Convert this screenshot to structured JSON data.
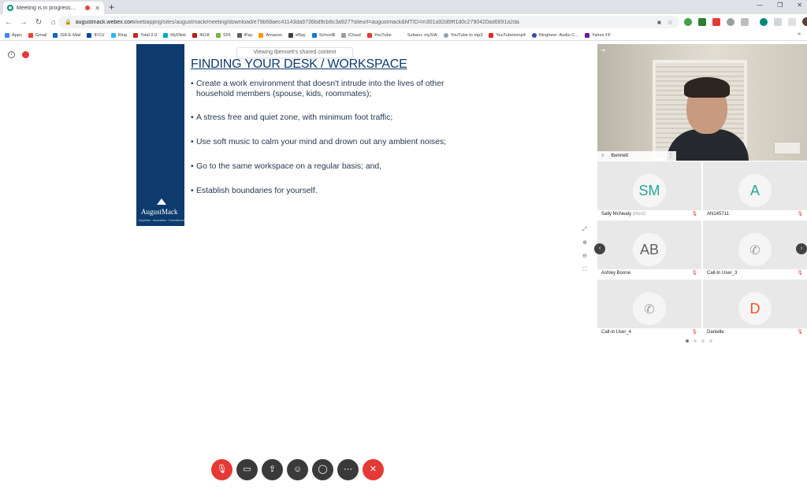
{
  "browser": {
    "tab_title": "Meeting is in progress...",
    "tab_close": "✕",
    "new_tab": "+",
    "url_host": "augustmack.webex.com",
    "url_path": "/webappng/sites/augustmack/meeting/download/e79b68aec41143da9736bd9cb8c3a927?siteurl=augustmack&MTID=m301a92d6fff1d0c2790420ad6891a2da",
    "bookmarks": [
      "Apps",
      "Gmail",
      "SIA E-Mail",
      "IFCU",
      "Ring",
      "Total 2.0",
      "MyDlink",
      "401K",
      "529",
      "iPay",
      "Amazon",
      "eBay",
      "School$",
      "iCloud",
      "YouTube",
      "Subaru- mySIA",
      "YouTube to mp3",
      "YouTubetomp4",
      "Ringtone- Audio C...",
      "Yahoo FF"
    ],
    "bookmarks_more": "»"
  },
  "meeting": {
    "share_banner": "Viewing tbennett's shared content",
    "slide": {
      "title": "FINDING YOUR DESK / WORKSPACE",
      "bullets": [
        "Create a work environment that doesn't intrude into the lives of other household members (spouse, kids, roommates);",
        "A stress free and quiet zone, with minimum foot traffic;",
        "Use soft music to calm your mind and drown out any ambient noises;",
        "Go to the same workspace on a regular basis; and,",
        "Establish boundaries for yourself."
      ],
      "brand": "AugustMack",
      "brand_tagline": "Expertise · Innovation · Commitment"
    },
    "active_speaker": "tbennett",
    "participants": [
      {
        "initials": "SM",
        "name": "Sally McNealy",
        "role": "(Host)",
        "color": "#26a69a"
      },
      {
        "initials": "A",
        "name": "AN145711",
        "role": "",
        "color": "#26a69a"
      },
      {
        "initials": "AB",
        "name": "Ashley Boone",
        "role": "",
        "color": "#616161"
      },
      {
        "initials": "",
        "name": "Call-In User_3",
        "role": "",
        "color": "#9e9e9e"
      },
      {
        "initials": "",
        "name": "Call-in User_4",
        "role": "",
        "color": "#9e9e9e"
      },
      {
        "initials": "D",
        "name": "Danielle",
        "role": "",
        "color": "#f4511e"
      }
    ],
    "colors": {
      "accent_red": "#e53935",
      "slide_blue": "#0d3b6e"
    }
  }
}
